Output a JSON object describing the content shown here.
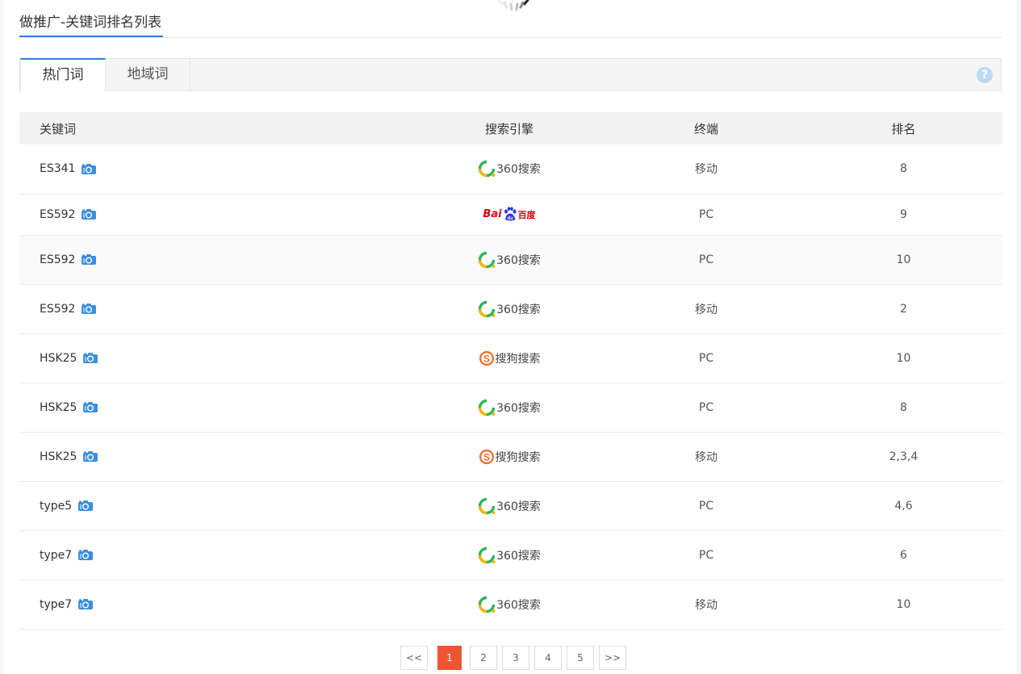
{
  "header": {
    "title": "做推广-关键词排名列表"
  },
  "tabs": [
    {
      "label": "热门词",
      "active": true
    },
    {
      "label": "地域词",
      "active": false
    }
  ],
  "help": {
    "glyph": "?"
  },
  "table": {
    "columns": [
      "关键词",
      "搜索引擎",
      "终端",
      "排名"
    ],
    "rows": [
      {
        "keyword": "ES341",
        "engine": "360",
        "terminal": "移动",
        "rank": "8"
      },
      {
        "keyword": "ES592",
        "engine": "baidu",
        "terminal": "PC",
        "rank": "9"
      },
      {
        "keyword": "ES592",
        "engine": "360",
        "terminal": "PC",
        "rank": "10"
      },
      {
        "keyword": "ES592",
        "engine": "360",
        "terminal": "移动",
        "rank": "2"
      },
      {
        "keyword": "HSK25",
        "engine": "sogou",
        "terminal": "PC",
        "rank": "10"
      },
      {
        "keyword": "HSK25",
        "engine": "360",
        "terminal": "PC",
        "rank": "8"
      },
      {
        "keyword": "HSK25",
        "engine": "sogou",
        "terminal": "移动",
        "rank": "2,3,4"
      },
      {
        "keyword": "type5",
        "engine": "360",
        "terminal": "PC",
        "rank": "4,6"
      },
      {
        "keyword": "type7",
        "engine": "360",
        "terminal": "PC",
        "rank": "6"
      },
      {
        "keyword": "type7",
        "engine": "360",
        "terminal": "移动",
        "rank": "10"
      }
    ]
  },
  "engines": {
    "360": {
      "label": "360搜索",
      "icon": "360-search-logo-icon"
    },
    "sogou": {
      "label": "搜狗搜索",
      "icon": "sogou-search-logo-icon"
    },
    "baidu": {
      "label_left": "Bai",
      "label_right": "百度",
      "icon": "baidu-logo-icon"
    }
  },
  "pagination": {
    "prev": "<<",
    "pages": [
      "1",
      "2",
      "3",
      "4",
      "5"
    ],
    "current": "1",
    "next": ">>"
  },
  "colors": {
    "accent": "#2f7fd8",
    "pager_active": "#ee5533",
    "camera_icon": "#3d8fdc",
    "logo_360_green": "#2db55d",
    "logo_360_yellow": "#f5b400",
    "sogou_orange": "#f26a25",
    "baidu_red": "#d7000f",
    "baidu_blue": "#2932e1"
  }
}
